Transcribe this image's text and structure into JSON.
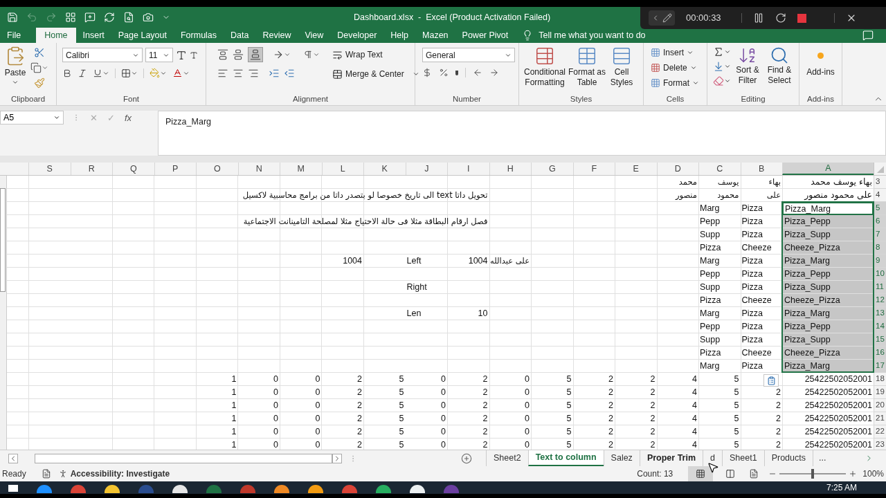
{
  "window": {
    "title": "Dashboard.xlsx  -  Excel (Product Activation Failed)"
  },
  "recorder": {
    "time": "00:00:33"
  },
  "ribbon_tabs": [
    {
      "label": "File",
      "selected": false
    },
    {
      "label": "Home",
      "selected": true
    },
    {
      "label": "Insert",
      "selected": false
    },
    {
      "label": "Page Layout",
      "selected": false
    },
    {
      "label": "Formulas",
      "selected": false
    },
    {
      "label": "Data",
      "selected": false
    },
    {
      "label": "Review",
      "selected": false
    },
    {
      "label": "View",
      "selected": false
    },
    {
      "label": "Developer",
      "selected": false
    },
    {
      "label": "Help",
      "selected": false
    },
    {
      "label": "Mazen",
      "selected": false
    },
    {
      "label": "Power Pivot",
      "selected": false
    }
  ],
  "tell_me": "Tell me what you want to do",
  "ribbon": {
    "clipboard": {
      "paste": "Paste",
      "label": "Clipboard"
    },
    "font": {
      "name": "Calibri",
      "size": "11",
      "label": "Font"
    },
    "alignment": {
      "wrap": "Wrap Text",
      "merge": "Merge & Center",
      "label": "Alignment"
    },
    "number": {
      "format": "General",
      "label": "Number"
    },
    "styles": {
      "buttons": [
        "Conditional Formatting",
        "Format as Table",
        "Cell Styles"
      ],
      "label": "Styles"
    },
    "cells": {
      "buttons": [
        "Insert",
        "Delete",
        "Format"
      ],
      "label": "Cells"
    },
    "editing": {
      "buttons": [
        "Sort & Filter",
        "Find & Select"
      ],
      "label": "Editing"
    },
    "addins": {
      "button": "Add-ins",
      "label": "Add-ins"
    }
  },
  "formula_bar": {
    "name_box": "A5",
    "cancel": "✕",
    "enter": "✓",
    "fx": "fx",
    "formula": "Pizza_Marg"
  },
  "sheet": {
    "columns": [
      {
        "label": "S",
        "selected": false
      },
      {
        "label": "R",
        "selected": false
      },
      {
        "label": "Q",
        "selected": false
      },
      {
        "label": "P",
        "selected": false
      },
      {
        "label": "O",
        "selected": false
      },
      {
        "label": "N",
        "selected": false
      },
      {
        "label": "M",
        "selected": false
      },
      {
        "label": "L",
        "selected": false
      },
      {
        "label": "K",
        "selected": false
      },
      {
        "label": "J",
        "selected": false
      },
      {
        "label": "I",
        "selected": false
      },
      {
        "label": "H",
        "selected": false
      },
      {
        "label": "G",
        "selected": false
      },
      {
        "label": "F",
        "selected": false
      },
      {
        "label": "E",
        "selected": false
      },
      {
        "label": "D",
        "selected": false
      },
      {
        "label": "C",
        "selected": false
      },
      {
        "label": "B",
        "selected": false
      },
      {
        "label": "A",
        "selected": true
      }
    ],
    "rows": [
      {
        "number": "3",
        "selected": false,
        "active": false,
        "cells": {
          "A": {
            "text": "بهاء يوسف محمد",
            "kind": "rtl"
          },
          "B": {
            "text": "بهاء",
            "kind": "rtl"
          },
          "C": {
            "text": "يوسف",
            "kind": "rtl"
          },
          "D": {
            "text": "محمد",
            "kind": "rtl"
          }
        }
      },
      {
        "number": "4",
        "selected": false,
        "active": false,
        "cells": {
          "A": {
            "text": "على محمود منصور",
            "kind": "rtl"
          },
          "B": {
            "text": "على",
            "kind": "rtl"
          },
          "C": {
            "text": "محمود",
            "kind": "rtl"
          },
          "D": {
            "text": "منصور",
            "kind": "rtl"
          },
          "I": {
            "text": "تحويل داتا text  الى تاريخ خصوصا لو بتصدر داتا من برامج محاسبية لاكسيل",
            "kind": "rtl"
          }
        }
      },
      {
        "number": "5",
        "selected": true,
        "active": true,
        "cells": {
          "A": {
            "text": "Pizza_Marg",
            "kind": "text"
          },
          "B": {
            "text": "Pizza",
            "kind": "text"
          },
          "C": {
            "text": "Marg",
            "kind": "text"
          }
        }
      },
      {
        "number": "6",
        "selected": true,
        "active": false,
        "cells": {
          "A": {
            "text": "Pizza_Pepp",
            "kind": "text"
          },
          "B": {
            "text": "Pizza",
            "kind": "text"
          },
          "C": {
            "text": "Pepp",
            "kind": "text"
          },
          "I": {
            "text": "فصل ارقام البطاقة مثلا فى حالة الاحتياج مثلا لمصلحة التامينانت الاجتماعية",
            "kind": "rtl"
          }
        }
      },
      {
        "number": "7",
        "selected": true,
        "active": false,
        "cells": {
          "A": {
            "text": "Pizza_Supp",
            "kind": "text"
          },
          "B": {
            "text": "Pizza",
            "kind": "text"
          },
          "C": {
            "text": "Supp",
            "kind": "text"
          }
        }
      },
      {
        "number": "8",
        "selected": true,
        "active": false,
        "cells": {
          "A": {
            "text": "Cheeze_Pizza",
            "kind": "text"
          },
          "B": {
            "text": "Cheeze",
            "kind": "text"
          },
          "C": {
            "text": "Pizza",
            "kind": "text"
          }
        }
      },
      {
        "number": "9",
        "selected": true,
        "active": false,
        "cells": {
          "A": {
            "text": "Pizza_Marg",
            "kind": "text"
          },
          "B": {
            "text": "Pizza",
            "kind": "text"
          },
          "C": {
            "text": "Marg",
            "kind": "text"
          },
          "H": {
            "text": "على عبدالله",
            "kind": "rtl"
          },
          "I": {
            "text": "1004",
            "kind": "num"
          },
          "J": {
            "text": "Left",
            "kind": "text"
          },
          "L": {
            "text": "1004",
            "kind": "num"
          }
        }
      },
      {
        "number": "10",
        "selected": true,
        "active": false,
        "cells": {
          "A": {
            "text": "Pizza_Pepp",
            "kind": "text"
          },
          "B": {
            "text": "Pizza",
            "kind": "text"
          },
          "C": {
            "text": "Pepp",
            "kind": "text"
          }
        }
      },
      {
        "number": "11",
        "selected": true,
        "active": false,
        "cells": {
          "A": {
            "text": "Pizza_Supp",
            "kind": "text"
          },
          "B": {
            "text": "Pizza",
            "kind": "text"
          },
          "C": {
            "text": "Supp",
            "kind": "text"
          },
          "J": {
            "text": "Right",
            "kind": "text"
          }
        }
      },
      {
        "number": "12",
        "selected": true,
        "active": false,
        "cells": {
          "A": {
            "text": "Cheeze_Pizza",
            "kind": "text"
          },
          "B": {
            "text": "Cheeze",
            "kind": "text"
          },
          "C": {
            "text": "Pizza",
            "kind": "text"
          }
        }
      },
      {
        "number": "13",
        "selected": true,
        "active": false,
        "cells": {
          "A": {
            "text": "Pizza_Marg",
            "kind": "text"
          },
          "B": {
            "text": "Pizza",
            "kind": "text"
          },
          "C": {
            "text": "Marg",
            "kind": "text"
          },
          "I": {
            "text": "10",
            "kind": "num"
          },
          "J": {
            "text": "Len",
            "kind": "text"
          }
        }
      },
      {
        "number": "14",
        "selected": true,
        "active": false,
        "cells": {
          "A": {
            "text": "Pizza_Pepp",
            "kind": "text"
          },
          "B": {
            "text": "Pizza",
            "kind": "text"
          },
          "C": {
            "text": "Pepp",
            "kind": "text"
          }
        }
      },
      {
        "number": "15",
        "selected": true,
        "active": false,
        "cells": {
          "A": {
            "text": "Pizza_Supp",
            "kind": "text"
          },
          "B": {
            "text": "Pizza",
            "kind": "text"
          },
          "C": {
            "text": "Supp",
            "kind": "text"
          }
        }
      },
      {
        "number": "16",
        "selected": true,
        "active": false,
        "cells": {
          "A": {
            "text": "Cheeze_Pizza",
            "kind": "text"
          },
          "B": {
            "text": "Cheeze",
            "kind": "text"
          },
          "C": {
            "text": "Pizza",
            "kind": "text"
          }
        }
      },
      {
        "number": "17",
        "selected": true,
        "active": false,
        "cells": {
          "A": {
            "text": "Pizza_Marg",
            "kind": "text"
          },
          "B": {
            "text": "Pizza",
            "kind": "text"
          },
          "C": {
            "text": "Marg",
            "kind": "text"
          }
        }
      },
      {
        "number": "18",
        "selected": false,
        "active": false,
        "cells": {
          "A": {
            "text": "25422502052001",
            "kind": "num"
          },
          "C": {
            "text": "5",
            "kind": "num"
          },
          "D": {
            "text": "4",
            "kind": "num"
          },
          "E": {
            "text": "2",
            "kind": "num"
          },
          "F": {
            "text": "2",
            "kind": "num"
          },
          "G": {
            "text": "5",
            "kind": "num"
          },
          "H": {
            "text": "0",
            "kind": "num"
          },
          "I": {
            "text": "2",
            "kind": "num"
          },
          "J": {
            "text": "0",
            "kind": "num"
          },
          "K": {
            "text": "5",
            "kind": "num"
          },
          "L": {
            "text": "2",
            "kind": "num"
          },
          "M": {
            "text": "0",
            "kind": "num"
          },
          "N": {
            "text": "0",
            "kind": "num"
          },
          "O": {
            "text": "1",
            "kind": "num"
          }
        }
      },
      {
        "number": "19",
        "selected": false,
        "active": false,
        "cells": {
          "A": {
            "text": "25422502052001",
            "kind": "num"
          },
          "B": {
            "text": "2",
            "kind": "num"
          },
          "C": {
            "text": "5",
            "kind": "num"
          },
          "D": {
            "text": "4",
            "kind": "num"
          },
          "E": {
            "text": "2",
            "kind": "num"
          },
          "F": {
            "text": "2",
            "kind": "num"
          },
          "G": {
            "text": "5",
            "kind": "num"
          },
          "H": {
            "text": "0",
            "kind": "num"
          },
          "I": {
            "text": "2",
            "kind": "num"
          },
          "J": {
            "text": "0",
            "kind": "num"
          },
          "K": {
            "text": "5",
            "kind": "num"
          },
          "L": {
            "text": "2",
            "kind": "num"
          },
          "M": {
            "text": "0",
            "kind": "num"
          },
          "N": {
            "text": "0",
            "kind": "num"
          },
          "O": {
            "text": "1",
            "kind": "num"
          }
        }
      },
      {
        "number": "20",
        "selected": false,
        "active": false,
        "cells": {
          "A": {
            "text": "25422502052001",
            "kind": "num"
          },
          "B": {
            "text": "2",
            "kind": "num"
          },
          "C": {
            "text": "5",
            "kind": "num"
          },
          "D": {
            "text": "4",
            "kind": "num"
          },
          "E": {
            "text": "2",
            "kind": "num"
          },
          "F": {
            "text": "2",
            "kind": "num"
          },
          "G": {
            "text": "5",
            "kind": "num"
          },
          "H": {
            "text": "0",
            "kind": "num"
          },
          "I": {
            "text": "2",
            "kind": "num"
          },
          "J": {
            "text": "0",
            "kind": "num"
          },
          "K": {
            "text": "5",
            "kind": "num"
          },
          "L": {
            "text": "2",
            "kind": "num"
          },
          "M": {
            "text": "0",
            "kind": "num"
          },
          "N": {
            "text": "0",
            "kind": "num"
          },
          "O": {
            "text": "1",
            "kind": "num"
          }
        }
      },
      {
        "number": "21",
        "selected": false,
        "active": false,
        "cells": {
          "A": {
            "text": "25422502052001",
            "kind": "num"
          },
          "B": {
            "text": "2",
            "kind": "num"
          },
          "C": {
            "text": "5",
            "kind": "num"
          },
          "D": {
            "text": "4",
            "kind": "num"
          },
          "E": {
            "text": "2",
            "kind": "num"
          },
          "F": {
            "text": "2",
            "kind": "num"
          },
          "G": {
            "text": "5",
            "kind": "num"
          },
          "H": {
            "text": "0",
            "kind": "num"
          },
          "I": {
            "text": "2",
            "kind": "num"
          },
          "J": {
            "text": "0",
            "kind": "num"
          },
          "K": {
            "text": "5",
            "kind": "num"
          },
          "L": {
            "text": "2",
            "kind": "num"
          },
          "M": {
            "text": "0",
            "kind": "num"
          },
          "N": {
            "text": "0",
            "kind": "num"
          },
          "O": {
            "text": "1",
            "kind": "num"
          }
        }
      },
      {
        "number": "22",
        "selected": false,
        "active": false,
        "cells": {
          "A": {
            "text": "25422502052001",
            "kind": "num"
          },
          "B": {
            "text": "2",
            "kind": "num"
          },
          "C": {
            "text": "5",
            "kind": "num"
          },
          "D": {
            "text": "4",
            "kind": "num"
          },
          "E": {
            "text": "2",
            "kind": "num"
          },
          "F": {
            "text": "2",
            "kind": "num"
          },
          "G": {
            "text": "5",
            "kind": "num"
          },
          "H": {
            "text": "0",
            "kind": "num"
          },
          "I": {
            "text": "2",
            "kind": "num"
          },
          "J": {
            "text": "0",
            "kind": "num"
          },
          "K": {
            "text": "5",
            "kind": "num"
          },
          "L": {
            "text": "2",
            "kind": "num"
          },
          "M": {
            "text": "0",
            "kind": "num"
          },
          "N": {
            "text": "0",
            "kind": "num"
          },
          "O": {
            "text": "1",
            "kind": "num"
          }
        }
      },
      {
        "number": "23",
        "selected": false,
        "active": false,
        "cells": {
          "A": {
            "text": "25422502052001",
            "kind": "num"
          },
          "B": {
            "text": "2",
            "kind": "num"
          },
          "C": {
            "text": "5",
            "kind": "num"
          },
          "D": {
            "text": "4",
            "kind": "num"
          },
          "E": {
            "text": "2",
            "kind": "num"
          },
          "F": {
            "text": "2",
            "kind": "num"
          },
          "G": {
            "text": "5",
            "kind": "num"
          },
          "H": {
            "text": "0",
            "kind": "num"
          },
          "I": {
            "text": "2",
            "kind": "num"
          },
          "J": {
            "text": "0",
            "kind": "num"
          },
          "K": {
            "text": "5",
            "kind": "num"
          },
          "L": {
            "text": "2",
            "kind": "num"
          },
          "M": {
            "text": "0",
            "kind": "num"
          },
          "N": {
            "text": "0",
            "kind": "num"
          },
          "O": {
            "text": "1",
            "kind": "num"
          }
        }
      }
    ]
  },
  "sheet_tabs": [
    {
      "label": "Sheet2",
      "selected": false,
      "hovered": false
    },
    {
      "label": "Text to column",
      "selected": true,
      "hovered": false
    },
    {
      "label": "Salez",
      "selected": false,
      "hovered": false
    },
    {
      "label": "Proper Trim",
      "selected": false,
      "hovered": true
    },
    {
      "label": "d",
      "selected": false,
      "hovered": false
    },
    {
      "label": "Sheet1",
      "selected": false,
      "hovered": false
    },
    {
      "label": "Products",
      "selected": false,
      "hovered": false
    }
  ],
  "more_tabs": "...",
  "status_bar": {
    "mode": "Ready",
    "accessibility": "Accessibility: Investigate",
    "count": "Count: 13",
    "zoom": {
      "level": 0.5,
      "reading": "100%"
    }
  },
  "taskbar": {
    "time": "7:25 AM"
  }
}
